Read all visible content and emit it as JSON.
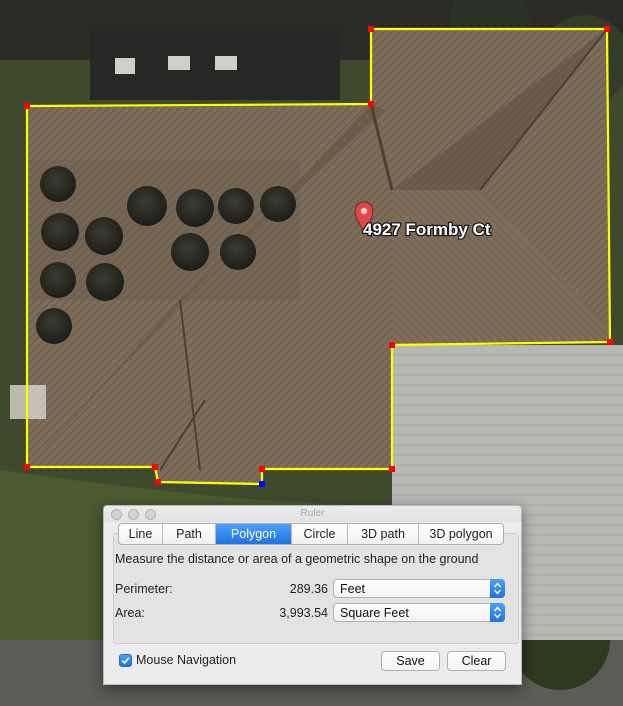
{
  "map": {
    "place_label": "4927 Formby Ct",
    "polygon_color": "#ffff00",
    "vertex_color": "#ff0000",
    "active_vertex_color": "#0000ff",
    "pin_color": "#e04848"
  },
  "ruler": {
    "title": "Ruler",
    "tabs": [
      {
        "label": "Line",
        "active": false
      },
      {
        "label": "Path",
        "active": false
      },
      {
        "label": "Polygon",
        "active": true
      },
      {
        "label": "Circle",
        "active": false
      },
      {
        "label": "3D path",
        "active": false
      },
      {
        "label": "3D polygon",
        "active": false
      }
    ],
    "description": "Measure the distance or area of a geometric shape on the ground",
    "perimeter": {
      "label": "Perimeter:",
      "value": "289.36",
      "unit": "Feet"
    },
    "area": {
      "label": "Area:",
      "value": "3,993.54",
      "unit": "Square Feet"
    },
    "mouse_navigation": {
      "label": "Mouse Navigation",
      "checked": true
    },
    "save_label": "Save",
    "clear_label": "Clear",
    "accent_color": "#2a86f0"
  }
}
